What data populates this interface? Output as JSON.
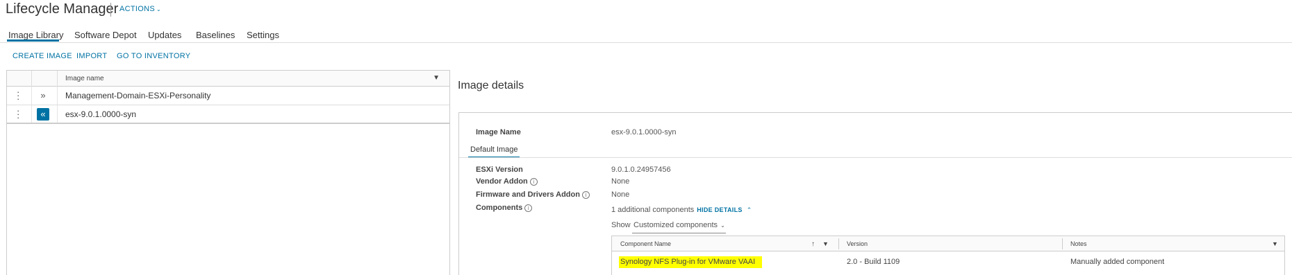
{
  "header": {
    "title": "Lifecycle Manager",
    "actions_label": "ACTIONS"
  },
  "tabs": [
    {
      "label": "Image Library",
      "active": true
    },
    {
      "label": "Software Depot"
    },
    {
      "label": "Updates"
    },
    {
      "label": "Baselines"
    },
    {
      "label": "Settings"
    }
  ],
  "toolbar": {
    "create_image": "CREATE IMAGE",
    "import": "IMPORT",
    "go_to_inventory": "GO TO INVENTORY"
  },
  "image_grid": {
    "column_header": "Image name",
    "rows": [
      {
        "name": "Management-Domain-ESXi-Personality",
        "selected": false
      },
      {
        "name": "esx-9.0.1.0000-syn",
        "selected": true
      }
    ]
  },
  "details": {
    "title": "Image details",
    "image_name_label": "Image Name",
    "image_name_value": "esx-9.0.1.0000-syn",
    "subtab": "Default Image",
    "esxi_version_label": "ESXi Version",
    "esxi_version_value": "9.0.1.0.24957456",
    "vendor_addon_label": "Vendor Addon",
    "vendor_addon_value": "None",
    "firmware_label": "Firmware and Drivers Addon",
    "firmware_value": "None",
    "components_label": "Components",
    "components_value": "1 additional components",
    "hide_details": "HIDE DETAILS",
    "show_label": "Show",
    "show_selected": "Customized components"
  },
  "components_table": {
    "headers": {
      "name": "Component Name",
      "version": "Version",
      "notes": "Notes"
    },
    "rows": [
      {
        "name": "Synology NFS Plug-in for VMware VAAI",
        "version": "2.0 - Build 1109",
        "notes": "Manually added component"
      }
    ]
  },
  "colors": {
    "accent": "#0072a3",
    "highlight": "#ffff00"
  }
}
